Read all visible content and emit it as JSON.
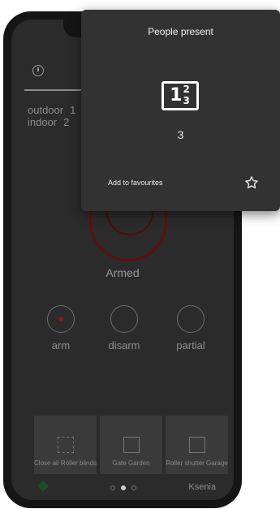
{
  "home": {
    "temps": [
      {
        "label": "outdoor",
        "value": "1"
      },
      {
        "label": "indoor",
        "value": "2"
      }
    ],
    "alarm_status": "Armed",
    "modes": [
      {
        "label": "arm",
        "selected": true
      },
      {
        "label": "disarm",
        "selected": false
      },
      {
        "label": "partial",
        "selected": false
      }
    ],
    "tiles": [
      {
        "label": "Close all Roller blinds",
        "icon": "blinds-icon"
      },
      {
        "label": "Gate Garden",
        "icon": "gate-icon"
      },
      {
        "label": "Roller shutter Garage",
        "icon": "shutter-icon"
      }
    ],
    "pager": {
      "count": 3,
      "active_index": 1
    },
    "brand": "Ksenia"
  },
  "popup": {
    "title": "People present",
    "icon": "people-counter-icon",
    "count": "3",
    "add_favourites": "Add to favourites"
  },
  "colors": {
    "background": "#2b2b2b",
    "popup_background": "#323232",
    "alarm_red": "#8a1a1a"
  }
}
